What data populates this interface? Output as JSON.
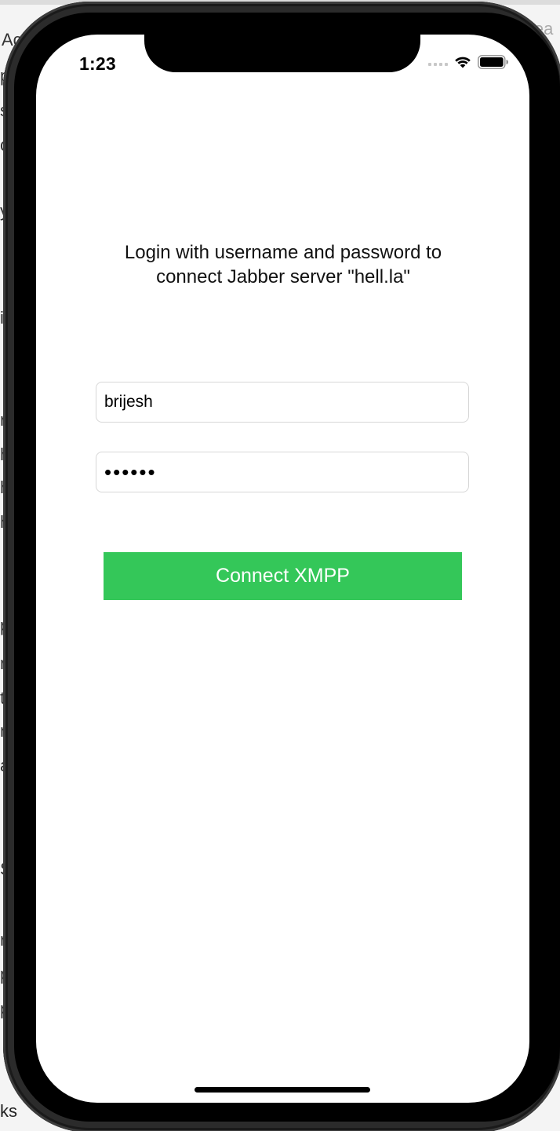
{
  "background": {
    "left_fragments": [
      "Ac",
      "p",
      "s",
      "c",
      "y",
      "i",
      "r",
      "h",
      "h",
      "h",
      "p",
      "n",
      "t",
      "n",
      "a",
      "S",
      "r",
      "p",
      "p"
    ],
    "top_right_fragment": "lea",
    "bottom_fragment": "ks"
  },
  "status_bar": {
    "time": "1:23",
    "icons": [
      "cellular-signal-icon",
      "wifi-icon",
      "battery-icon"
    ]
  },
  "login": {
    "instructions_line1": "Login with username and password to",
    "instructions_line2": "connect Jabber server \"hell.la\"",
    "username_value": "brijesh",
    "password_value": "••••••",
    "connect_button_label": "Connect XMPP"
  },
  "colors": {
    "button_green": "#34c759",
    "screen_bg": "#ffffff",
    "bezel": "#000000"
  }
}
